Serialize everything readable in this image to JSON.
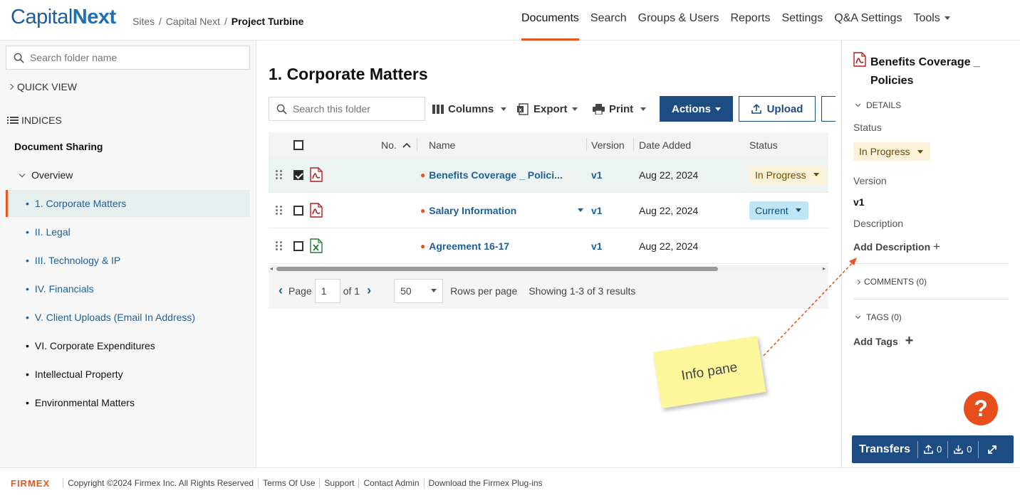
{
  "header": {
    "logo_part1": "Capital",
    "logo_part2": "Next",
    "breadcrumb": [
      "Sites",
      "Capital Next",
      "Project Turbine"
    ],
    "breadcrumb_sep": "/",
    "nav": [
      "Documents",
      "Search",
      "Groups & Users",
      "Reports",
      "Settings",
      "Q&A Settings",
      "Tools"
    ],
    "active_nav": "Documents"
  },
  "sidebar": {
    "search_placeholder": "Search folder name",
    "quick_view": "QUICK VIEW",
    "indices": "INDICES",
    "section": "Document Sharing",
    "overview": "Overview",
    "folders": [
      {
        "label": "1. Corporate Matters",
        "active": true
      },
      {
        "label": "II. Legal"
      },
      {
        "label": "III. Technology & IP"
      },
      {
        "label": "IV. Financials"
      },
      {
        "label": "V. Client Uploads (Email In Address)"
      },
      {
        "label": "VI. Corporate Expenditures"
      },
      {
        "label": "Intellectual Property"
      },
      {
        "label": "Environmental Matters"
      }
    ]
  },
  "main": {
    "title": "1. Corporate Matters",
    "search_placeholder": "Search this folder",
    "toolbar": {
      "columns": "Columns",
      "export": "Export",
      "print": "Print",
      "actions": "Actions",
      "upload": "Upload"
    },
    "columns": {
      "no": "No.",
      "name": "Name",
      "version": "Version",
      "date": "Date Added",
      "status": "Status"
    },
    "rows": [
      {
        "name": "Benefits Coverage _ Polici...",
        "version": "v1",
        "date": "Aug 22, 2024",
        "status": "In Progress",
        "file": "pdf",
        "checked": true
      },
      {
        "name": "Salary Information",
        "version": "v1",
        "date": "Aug 22, 2024",
        "status": "Current",
        "file": "pdf",
        "checked": false
      },
      {
        "name": "Agreement 16-17",
        "version": "v1",
        "date": "Aug 22, 2024",
        "status": "",
        "file": "xls",
        "checked": false
      }
    ],
    "pager": {
      "page_label": "Page",
      "page": "1",
      "of": "of 1",
      "rows_value": "50",
      "rows_label": "Rows per page",
      "showing": "Showing 1-3 of 3 results"
    }
  },
  "info_pane": {
    "title": "Benefits Coverage _ Policies",
    "details": "DETAILS",
    "status_label": "Status",
    "status_value": "In Progress",
    "version_label": "Version",
    "version_value": "v1",
    "description_label": "Description",
    "add_description": "Add Description",
    "comments": "COMMENTS (0)",
    "tags": "TAGS (0)",
    "add_tags": "Add Tags"
  },
  "annotation": {
    "sticky_note": "Info pane"
  },
  "transfers": {
    "label": "Transfers",
    "up": "0",
    "down": "0"
  },
  "footer": {
    "brand": "FIRMEX",
    "links": [
      "Copyright ©2024 Firmex Inc. All Rights Reserved",
      "Terms Of Use",
      "Support",
      "Contact Admin",
      "Download the Firmex Plug-ins"
    ]
  },
  "colors": {
    "accent": "#e8561f",
    "primary": "#1c4c82",
    "link": "#1f5f96"
  }
}
